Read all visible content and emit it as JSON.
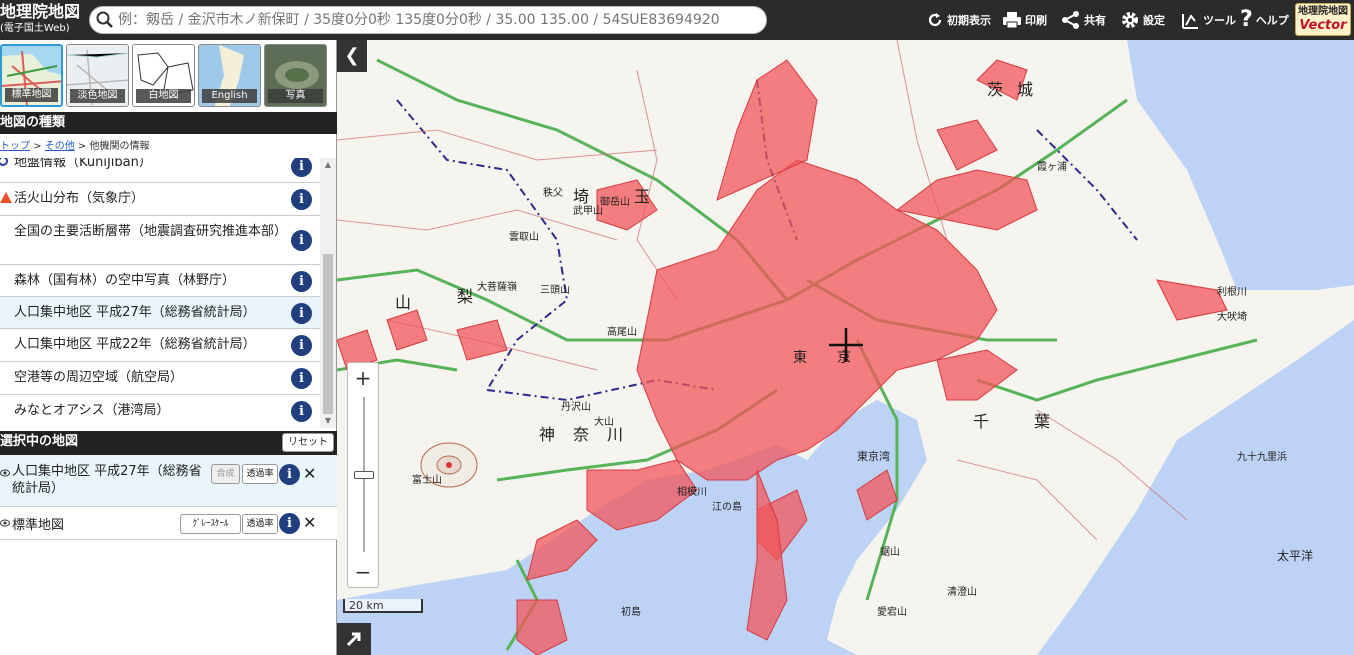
{
  "header": {
    "logo_line1": "地理院地図",
    "logo_line2": "(電子国土Web)",
    "search_placeholder": "例：剱岳 / 金沢市木ノ新保町 / 35度0分0秒 135度0分0秒 / 35.00 135.00 / 54SUE83694920",
    "buttons": {
      "reset_view": "初期表示",
      "print": "印刷",
      "share": "共有",
      "settings": "設定",
      "tools": "ツール",
      "help": "ヘルプ"
    },
    "vector_logo_line1": "地理院地図",
    "vector_logo_line2": "Vector"
  },
  "basemaps": [
    {
      "label": "標準地図",
      "active": true
    },
    {
      "label": "淡色地図",
      "active": false
    },
    {
      "label": "白地図",
      "active": false
    },
    {
      "label": "English",
      "active": false
    },
    {
      "label": "写真",
      "active": false
    }
  ],
  "map_types": {
    "title": "地図の種類",
    "breadcrumb": {
      "top": "トップ",
      "sep1": " > ",
      "other": "その他",
      "sep2": " > ",
      "current": "他機関の情報"
    },
    "items": [
      {
        "label": "地盤情報（KuniJiban）",
        "icon": "ring-icon"
      },
      {
        "label": "活火山分布（気象庁）",
        "icon": "triangle-icon"
      },
      {
        "label": "全国の主要活断層帯（地震調査研究推進本部）",
        "icon": ""
      },
      {
        "label": "森林（国有林）の空中写真（林野庁）",
        "icon": ""
      },
      {
        "label": "人口集中地区 平成27年（総務省統計局）",
        "icon": "",
        "selected": true
      },
      {
        "label": "人口集中地区 平成22年（総務省統計局）",
        "icon": ""
      },
      {
        "label": "空港等の周辺空域（航空局）",
        "icon": ""
      },
      {
        "label": "みなとオアシス（港湾局）",
        "icon": ""
      }
    ],
    "info_label": "i"
  },
  "selected_maps": {
    "title": "選択中の地図",
    "reset_label": "リセット",
    "items": [
      {
        "label": "人口集中地区 平成27年（総務省統計局）",
        "btn1": "合成",
        "btn2": "透過率"
      },
      {
        "label": "標準地図",
        "btn1": "ｸﾞﾚｰｽｹｰﾙ",
        "btn2": "透過率"
      }
    ],
    "close_label": "✕"
  },
  "map": {
    "zoom_in": "+",
    "zoom_out": "−",
    "collapse": "❮",
    "scale_label": "20 km",
    "place_labels": [
      "茨",
      "城",
      "埼",
      "玉",
      "山",
      "梨",
      "神",
      "奈",
      "川",
      "千",
      "葉",
      "東",
      "京",
      "秩父",
      "武甲山",
      "雲取山",
      "大菩薩嶺",
      "三頭山",
      "御岳山",
      "丹沢山",
      "大山",
      "富士山",
      "江の島",
      "相模川",
      "利根川",
      "九十九里浜",
      "太平洋",
      "初島",
      "高尾山",
      "鋸山",
      "清澄山",
      "愛宕山",
      "東京湾",
      "大吠埼",
      "霞ヶ浦"
    ],
    "colors": {
      "dense": "#f2555a",
      "sea": "#bcd3f6",
      "land": "#f6f4ef",
      "road": "#57b357"
    }
  }
}
